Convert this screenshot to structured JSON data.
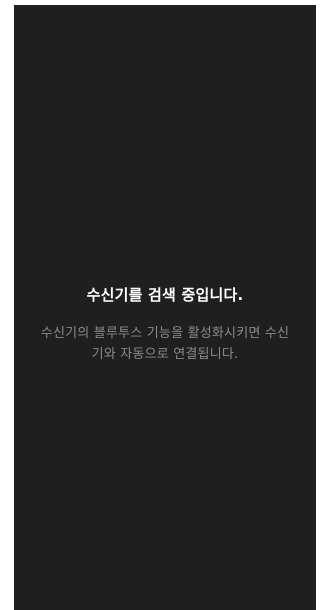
{
  "screen": {
    "title": "수신기를 검색 중입니다.",
    "description": "수신기의 블루투스 기능을 활성화시키면 수신\n기와 자동으로 연결됩니다."
  }
}
